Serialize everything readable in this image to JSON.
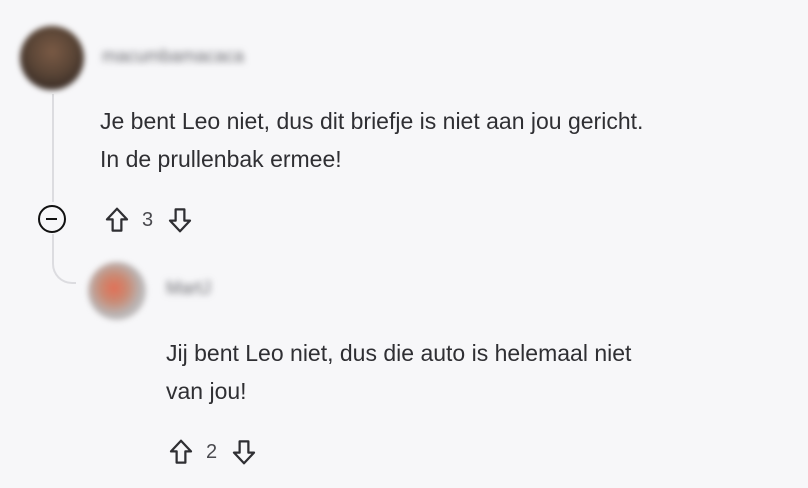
{
  "comments": [
    {
      "username": "macumbamacaca",
      "text_lines": [
        "Je bent Leo niet, dus dit briefje is niet aan jou gericht.",
        "In de prullenbak ermee!"
      ],
      "votes": "3"
    },
    {
      "username": "MartJ",
      "text_lines": [
        "Jij bent Leo niet, dus die auto is helemaal niet",
        "van jou!"
      ],
      "votes": "2"
    }
  ],
  "icons": {
    "collapse": "minus-circle-icon",
    "upvote": "arrow-up-icon",
    "downvote": "arrow-down-icon"
  }
}
